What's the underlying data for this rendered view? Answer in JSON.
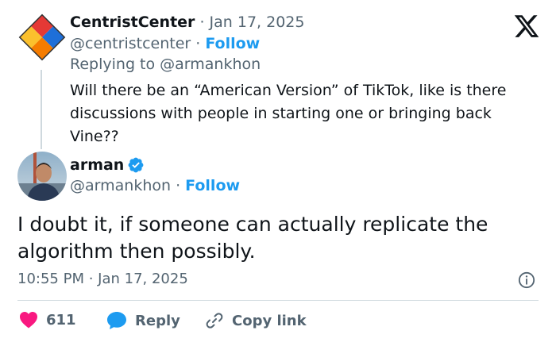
{
  "reply_tweet": {
    "display_name": "CentristCenter",
    "date_sep": " · ",
    "date": "Jan 17, 2025",
    "handle": "@centristcenter",
    "handle_sep": " · ",
    "follow_label": "Follow",
    "replying_prefix": "Replying to ",
    "replying_to": "@armankhon",
    "text": "Will there be an “American Version” of TikTok, like is there discussions with people in starting one or bringing back Vine??"
  },
  "main_tweet": {
    "display_name": "arman",
    "verified": true,
    "handle": "@armankhon",
    "handle_sep": " · ",
    "follow_label": "Follow",
    "text": "I doubt it, if someone can actually replicate the algorithm then possibly.",
    "timestamp": "10:55 PM · Jan 17, 2025"
  },
  "actions": {
    "like_count": "611",
    "reply_label": "Reply",
    "copy_link_label": "Copy link"
  },
  "colors": {
    "accent": "#1d9bf0",
    "like": "#f91880",
    "text_secondary": "#536471",
    "text_primary": "#0f1419"
  },
  "icons": [
    "x-logo-icon",
    "verified-badge-icon",
    "info-icon",
    "heart-icon",
    "reply-bubble-icon",
    "link-icon"
  ]
}
